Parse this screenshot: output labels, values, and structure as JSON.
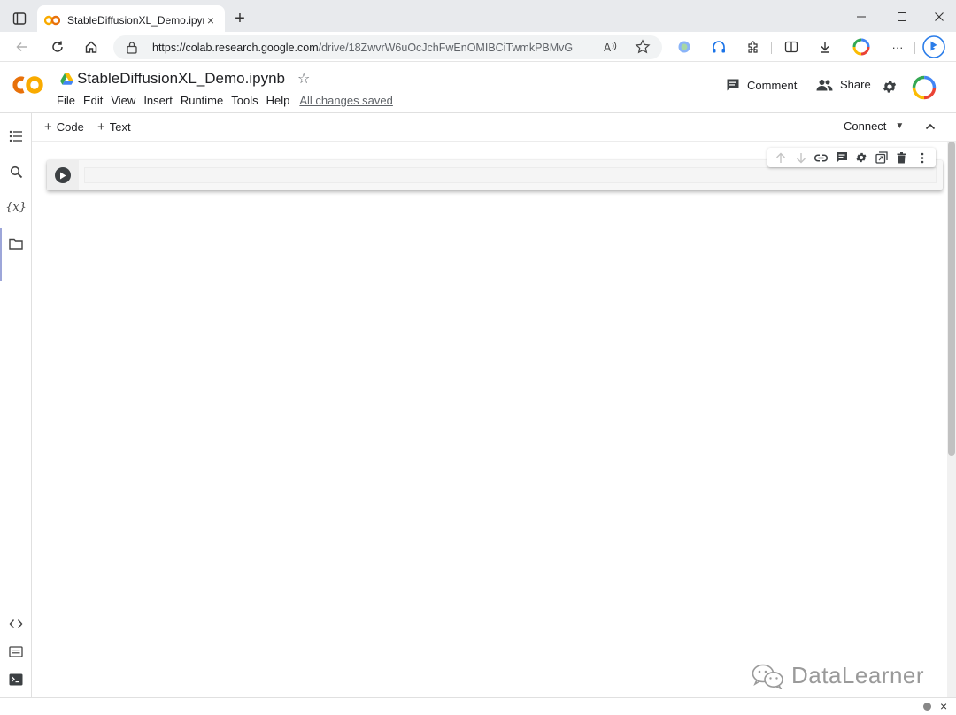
{
  "browser": {
    "tab_title": "StableDiffusionXL_Demo.ipynb - ",
    "tab_close": "×",
    "new_tab": "+",
    "url_host": "https://colab.research.google.com",
    "url_path": "/drive/18ZwvrW6uOcJchFwEnOMIBCiTwmkPBMvG",
    "more_label": "···"
  },
  "colab": {
    "logo_text": "CO",
    "notebook_title": "StableDiffusionXL_Demo.ipynb",
    "star": "☆",
    "menu": [
      "File",
      "Edit",
      "View",
      "Insert",
      "Runtime",
      "Tools",
      "Help"
    ],
    "save_status": "All changes saved",
    "comment_label": "Comment",
    "share_label": "Share"
  },
  "rail": {
    "variables_label": "{x}"
  },
  "toolbar": {
    "add_code": "Code",
    "add_text": "Text",
    "plus": "+",
    "connect_label": "Connect",
    "connect_caret": "▼"
  },
  "status": {
    "close": "×"
  },
  "watermark": {
    "text": "DataLearner"
  },
  "colors": {
    "colab_orange": "#F9AB00",
    "colab_orange_dark": "#E8710A",
    "accent": "#5c6bc0"
  }
}
